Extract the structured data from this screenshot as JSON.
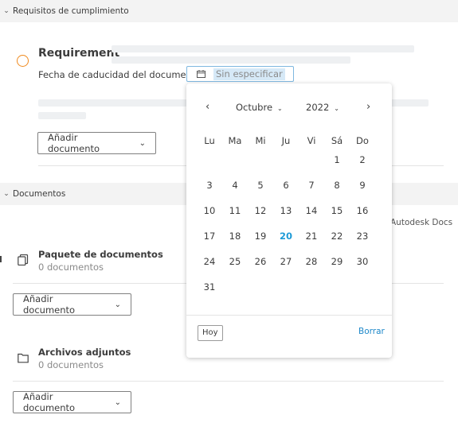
{
  "sections": {
    "requirements_header": "Requisitos de cumplimiento",
    "documents_header": "Documentos"
  },
  "requirement": {
    "title": "Requirement",
    "date_label": "Fecha de caducidad del documento",
    "date_placeholder": "Sin especificar",
    "add_button": "Añadir documento"
  },
  "documents": {
    "source_label": "Autodesk Docs",
    "groups": [
      {
        "title": "Paquete de documentos",
        "count": "0 documentos",
        "add_button": "Añadir documento"
      },
      {
        "title": "Archivos adjuntos",
        "count": "0 documentos",
        "add_button": "Añadir documento"
      }
    ]
  },
  "calendar": {
    "prev": "‹",
    "next": "›",
    "month": "Octubre",
    "year": "2022",
    "weekdays": [
      "Lu",
      "Ma",
      "Mi",
      "Ju",
      "Vi",
      "Sá",
      "Do"
    ],
    "weeks": [
      [
        "",
        "",
        "",
        "",
        "",
        "1",
        "2"
      ],
      [
        "3",
        "4",
        "5",
        "6",
        "7",
        "8",
        "9"
      ],
      [
        "10",
        "11",
        "12",
        "13",
        "14",
        "15",
        "16"
      ],
      [
        "17",
        "18",
        "19",
        "20",
        "21",
        "22",
        "23"
      ],
      [
        "24",
        "25",
        "26",
        "27",
        "28",
        "29",
        "30"
      ],
      [
        "31",
        "",
        "",
        "",
        "",
        "",
        ""
      ]
    ],
    "today": "20",
    "today_button": "Hoy",
    "clear_button": "Borrar"
  },
  "colors": {
    "status_ring": "#f08a1e",
    "today": "#1e9bd7",
    "link": "#1e88c9",
    "input_focus": "#7fb8e0"
  }
}
